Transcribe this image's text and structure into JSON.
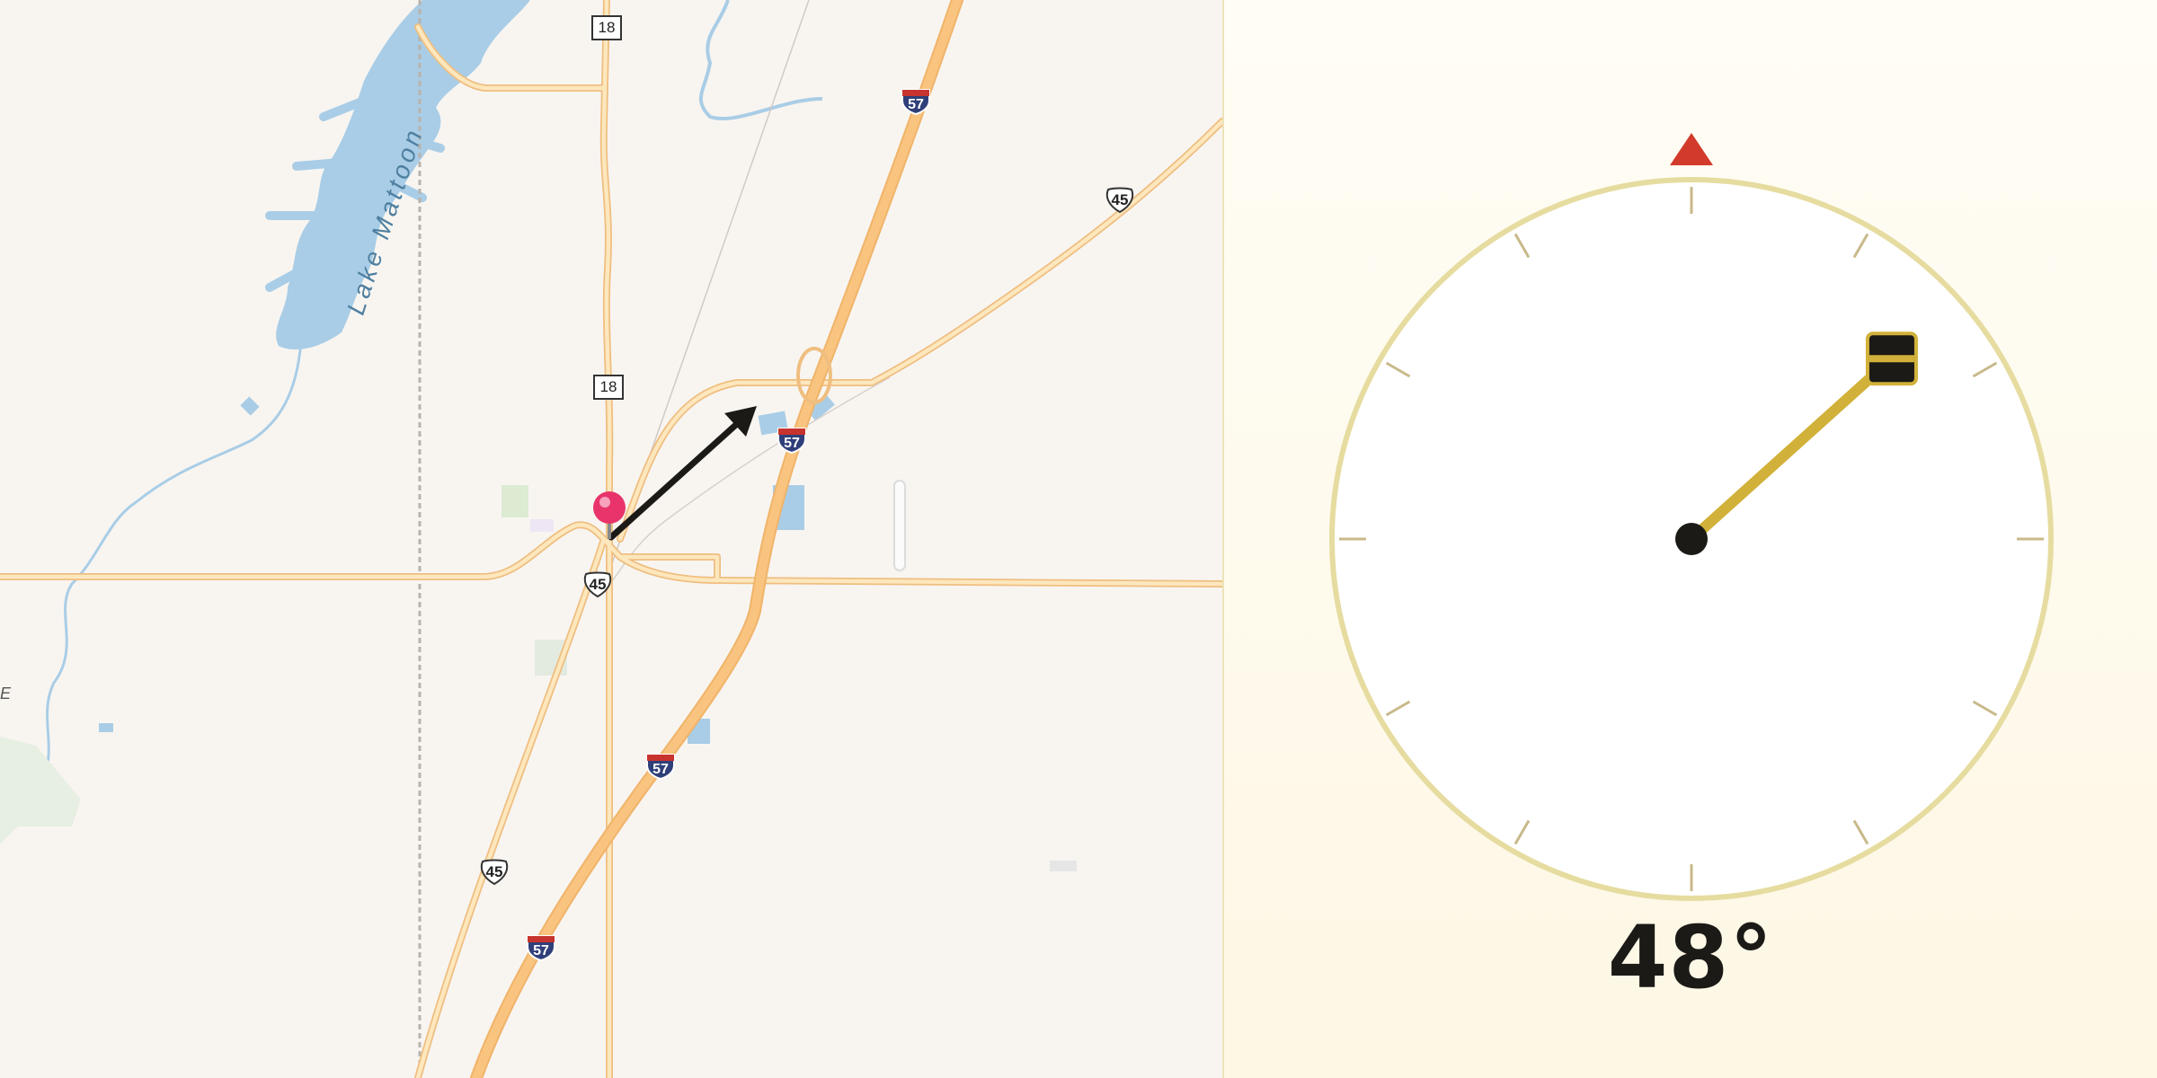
{
  "map": {
    "lake_name": "Lake Mattoon",
    "edge_label": "E",
    "route_shields": [
      {
        "type": "state",
        "number": "18"
      },
      {
        "type": "state",
        "number": "18"
      },
      {
        "type": "interstate",
        "number": "57"
      },
      {
        "type": "interstate",
        "number": "57"
      },
      {
        "type": "interstate",
        "number": "57"
      },
      {
        "type": "interstate",
        "number": "57"
      },
      {
        "type": "us",
        "number": "45"
      },
      {
        "type": "us",
        "number": "45"
      },
      {
        "type": "us",
        "number": "45"
      }
    ],
    "pin_color": "#e8346a",
    "road_color": "#f7c47e",
    "water_color": "#a9cde6"
  },
  "compass": {
    "heading_deg": 48,
    "heading_label": "48°",
    "north_marker_color": "#d23b2b",
    "ring_color": "#e6dca0",
    "needle_color": "#d1b13a",
    "hub_color": "#1c1a17"
  }
}
